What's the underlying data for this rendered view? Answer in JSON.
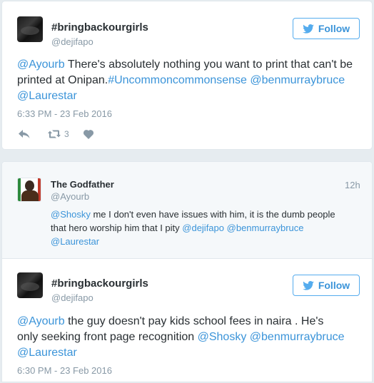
{
  "tweet1": {
    "display_name": "#bringbackourgirls",
    "handle": "@dejifapo",
    "follow_label": "Follow",
    "text_parts": {
      "m1": "@Ayourb",
      "t1": " There's absolutely nothing you want to print that can't be printed at Onipan.",
      "h1": "#Uncommoncommonsense",
      "t2": " ",
      "m2": "@benmurraybruce",
      "t3": " ",
      "m3": "@Laurestar"
    },
    "timestamp": "6:33 PM - 23 Feb 2016",
    "retweet_count": "3"
  },
  "reply": {
    "display_name": "The Godfather",
    "handle": "@Ayourb",
    "time_ago": "12h",
    "text_parts": {
      "m1": "@Shosky",
      "t1": " me I don't even have issues with him, it is the dumb people that hero worship him that I pity ",
      "m2": "@dejifapo",
      "t2": " ",
      "m3": "@benmurraybruce",
      "t3": " ",
      "m4": "@Laurestar"
    }
  },
  "tweet2": {
    "display_name": "#bringbackourgirls",
    "handle": "@dejifapo",
    "follow_label": "Follow",
    "text_parts": {
      "m1": "@Ayourb",
      "t1": " the guy doesn't pay kids school fees in naira . He's only seeking front page recognition ",
      "m2": "@Shosky",
      "t2": " ",
      "m3": "@benmurraybruce",
      "t3": " ",
      "m4": "@Laurestar"
    },
    "timestamp": "6:30 PM - 23 Feb 2016"
  },
  "colors": {
    "link": "#3b94d9",
    "follow_border": "#55acee",
    "muted": "#8899a6",
    "text": "#292f33",
    "background": "#e6ecf0"
  },
  "icons": {
    "follow": "twitter-bird-icon",
    "reply": "reply-arrow-icon",
    "retweet": "retweet-icon",
    "like": "heart-icon"
  }
}
